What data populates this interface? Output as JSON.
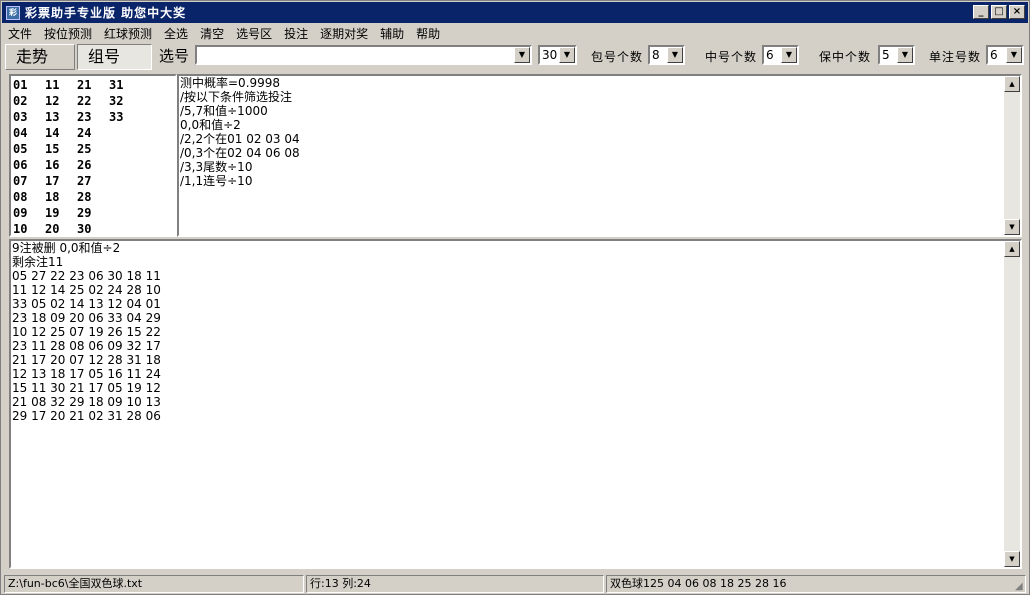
{
  "window": {
    "title": "彩票助手专业版   助您中大奖",
    "minimize": "_",
    "maximize": "□",
    "close": "×",
    "app_icon": "lottery-app-icon"
  },
  "menu": [
    "文件",
    "按位预测",
    "红球预测",
    "全选",
    "清空",
    "选号区",
    "投注",
    "逐期对奖",
    "辅助",
    "帮助"
  ],
  "toolbar": {
    "tab_trend": "走势",
    "tab_group": "组号",
    "select_label": "选号",
    "select_value": "",
    "count_value": "30",
    "bao_label": "包号个数",
    "bao_value": "8",
    "zhong_label": "中号个数",
    "zhong_value": "6",
    "bao_zhong_label": "保中个数",
    "bao_zhong_value": "5",
    "dan_label": "单注号数",
    "dan_value": "6"
  },
  "numbers": [
    [
      "01",
      "11",
      "21",
      "31"
    ],
    [
      "02",
      "12",
      "22",
      "32"
    ],
    [
      "03",
      "13",
      "23",
      "33"
    ],
    [
      "04",
      "14",
      "24",
      ""
    ],
    [
      "05",
      "15",
      "25",
      ""
    ],
    [
      "06",
      "16",
      "26",
      ""
    ],
    [
      "07",
      "17",
      "27",
      ""
    ],
    [
      "08",
      "18",
      "28",
      ""
    ],
    [
      "09",
      "19",
      "29",
      ""
    ],
    [
      "10",
      "20",
      "30",
      ""
    ]
  ],
  "editor_lines": [
    "测中概率=0.9998",
    "/按以下条件筛选投注",
    "/5,7和值÷1000",
    "0,0和值÷2",
    "/2,2个在01 02 03 04",
    "/0,3个在02 04 06 08",
    "/3,3尾数÷10",
    "/1,1连号÷10"
  ],
  "output_lines": [
    "9注被删 0,0和值÷2",
    "剩余注11",
    "05 27 22 23 06 30 18 11",
    "11 12 14 25 02 24 28 10",
    "33 05 02 14 13 12 04 01",
    "23 18 09 20 06 33 04 29",
    "10 12 25 07 19 26 15 22",
    "23 11 28 08 06 09 32 17",
    "21 17 20 07 12 28 31 18",
    "12 13 18 17 05 16 11 24",
    "15 11 30 21 17 05 19 12",
    "21 08 32 29 18 09 10 13",
    "29 17 20 21 02 31 28 06"
  ],
  "status": {
    "path": "Z:\\fun-bc6\\全国双色球.txt",
    "position": "行:13  列:24",
    "info": "双色球125 04 06 08 18 25 28 16"
  }
}
